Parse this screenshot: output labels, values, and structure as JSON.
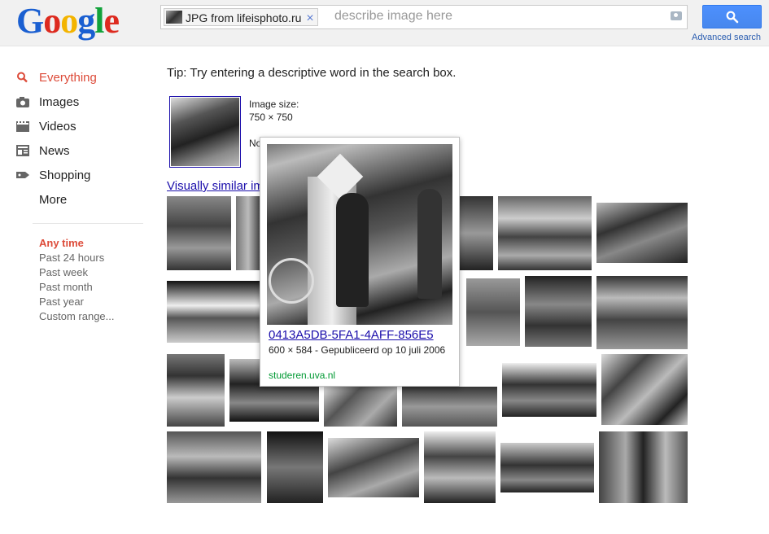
{
  "header": {
    "logo_letters": [
      "G",
      "o",
      "o",
      "g",
      "l",
      "e"
    ],
    "logo_colors": [
      "#1a5fd1",
      "#dd2a1f",
      "#f3b400",
      "#1a5fd1",
      "#11a23a",
      "#dd2a1f"
    ],
    "chip_label": "JPG from lifeisphoto.ru",
    "chip_close": "×",
    "placeholder": "describe image here",
    "advanced_search": "Advanced search"
  },
  "nav": {
    "items": [
      {
        "label": "Everything",
        "icon": "search-icon",
        "selected": true
      },
      {
        "label": "Images",
        "icon": "camera-icon",
        "selected": false
      },
      {
        "label": "Videos",
        "icon": "film-icon",
        "selected": false
      },
      {
        "label": "News",
        "icon": "newspaper-icon",
        "selected": false
      },
      {
        "label": "Shopping",
        "icon": "tag-icon",
        "selected": false
      },
      {
        "label": "More",
        "icon": "",
        "selected": false
      }
    ],
    "time_filters": [
      "Any time",
      "Past 24 hours",
      "Past week",
      "Past month",
      "Past year",
      "Custom range..."
    ]
  },
  "main": {
    "tip": "Tip: Try entering a descriptive word in the search box.",
    "image_size_label": "Image size:",
    "image_size_value": "750 × 750",
    "not_shown_prefix": "No",
    "visually_similar": "Visually similar images"
  },
  "popup": {
    "title": "0413A5DB-5FA1-4AFF-856E5",
    "meta": "600 × 584 - Gepubliceerd op 10 juli 2006",
    "source": "studeren.uva.nl"
  },
  "colors": {
    "accent": "#dd4b39",
    "link": "#1a0dab",
    "button": "#4d90fe",
    "source_green": "#093"
  }
}
